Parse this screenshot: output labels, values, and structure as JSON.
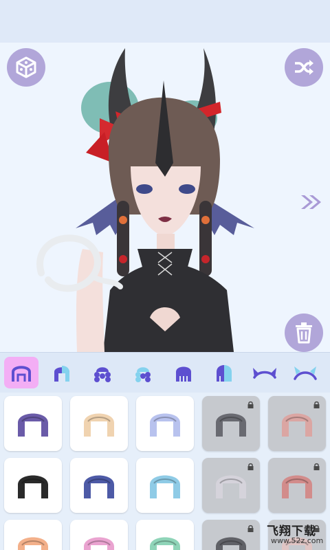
{
  "toolbar": {
    "dice_icon": "dice-icon",
    "shuffle_icon": "shuffle-icon",
    "next_icon": "double-chevron-right-icon",
    "delete_icon": "trash-icon",
    "button_color": "#b1a6d9"
  },
  "category_tabs": [
    {
      "icon": "hair-full-icon",
      "active": true
    },
    {
      "icon": "hair-front-icon",
      "active": false
    },
    {
      "icon": "hair-curly-icon",
      "active": false
    },
    {
      "icon": "hair-side-icon",
      "active": false
    },
    {
      "icon": "hair-back-icon",
      "active": false
    },
    {
      "icon": "hair-split-icon",
      "active": false
    },
    {
      "icon": "horns-icon",
      "active": false
    },
    {
      "icon": "headband-icon",
      "active": false
    }
  ],
  "hair_items": [
    {
      "color": "#6a5ba8",
      "locked": false
    },
    {
      "color": "#f0d3b0",
      "locked": false
    },
    {
      "color": "#b8c2ee",
      "locked": false
    },
    {
      "color": "#4a4a52",
      "locked": true
    },
    {
      "color": "#e29a94",
      "locked": true
    },
    {
      "color": "#2a2a2a",
      "locked": false
    },
    {
      "color": "#4d5aa6",
      "locked": false
    },
    {
      "color": "#8fcbe6",
      "locked": false
    },
    {
      "color": "#d9d6df",
      "locked": true
    },
    {
      "color": "#d67774",
      "locked": true
    },
    {
      "color": "#f3b08a",
      "locked": false
    },
    {
      "color": "#eaa3d0",
      "locked": false
    },
    {
      "color": "#8fd4b8",
      "locked": false
    },
    {
      "color": "#3e3e44",
      "locked": true
    },
    {
      "color": "#e8c3c0",
      "locked": true
    }
  ],
  "watermark": {
    "title": "飞翔下载",
    "url": "www.52z.com"
  }
}
